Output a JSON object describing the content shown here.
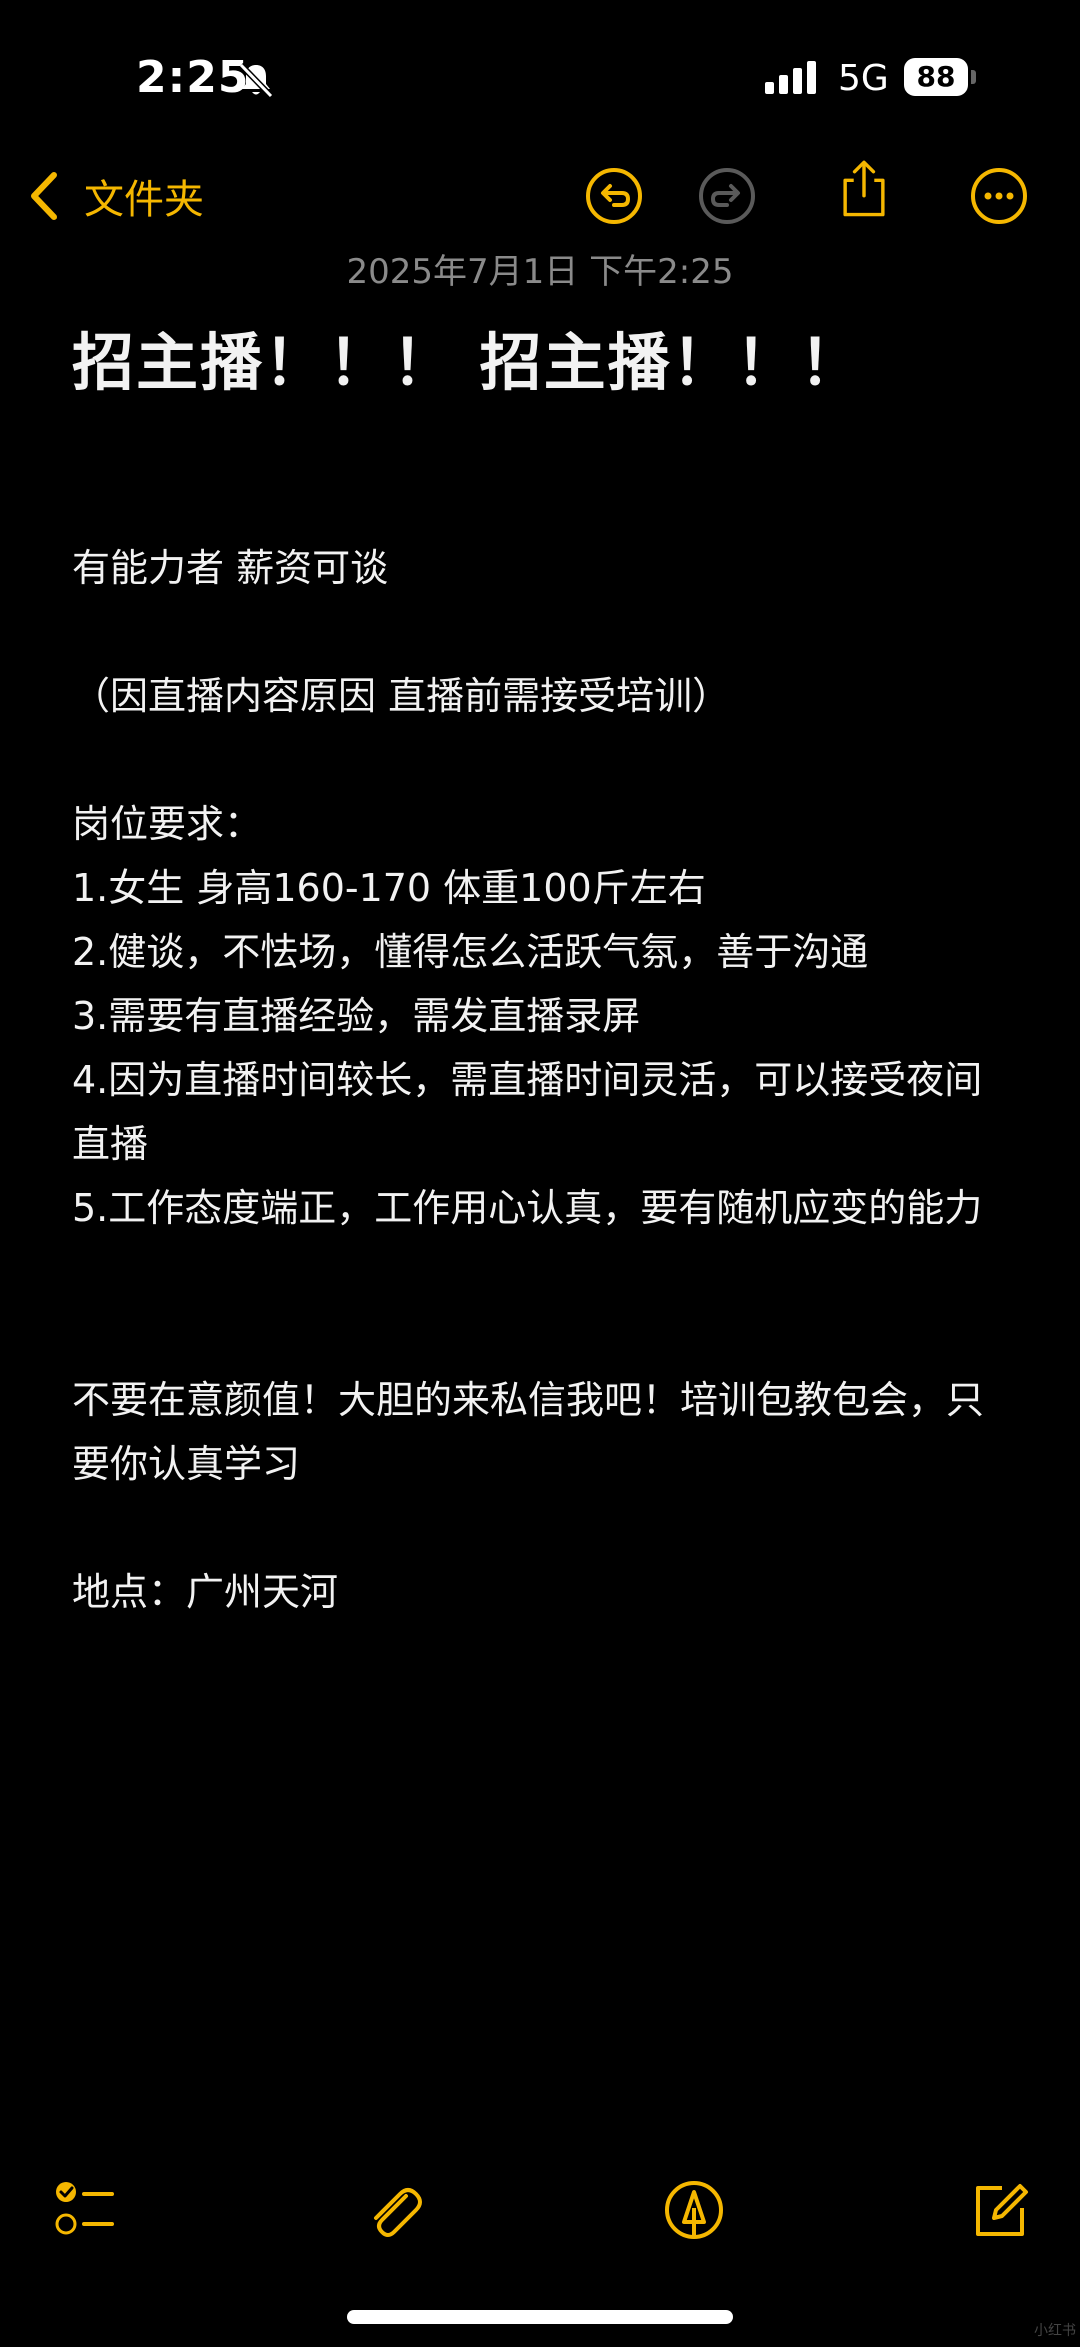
{
  "status_bar": {
    "time": "2:25",
    "network": "5G",
    "battery": "88"
  },
  "nav": {
    "back_label": "文件夹"
  },
  "note": {
    "date": "2025年7月1日 下午2:25",
    "title": "招主播！！！ 招主播！！！",
    "lines": {
      "l1": "有能力者 薪资可谈",
      "l2": "（因直播内容原因 直播前需接受培训）",
      "l3": "岗位要求：",
      "l4": "1.女生  身高160-170  体重100斤左右",
      "l5": "2.健谈，不怯场，懂得怎么活跃气氛，善于沟通",
      "l6": "3.需要有直播经验，需发直播录屏",
      "l7": "4.因为直播时间较长，需直播时间灵活，可以接受夜间直播",
      "l8": "5.工作态度端正，工作用心认真，要有随机应变的能力",
      "l9": "不要在意颜值！大胆的来私信我吧！培训包教包会，只要你认真学习",
      "l10": "地点：广州天河"
    }
  },
  "watermark": "小红书",
  "colors": {
    "accent": "#f5b700",
    "background": "#000000",
    "text": "#f2f2f2",
    "muted": "#8a8a8a"
  }
}
